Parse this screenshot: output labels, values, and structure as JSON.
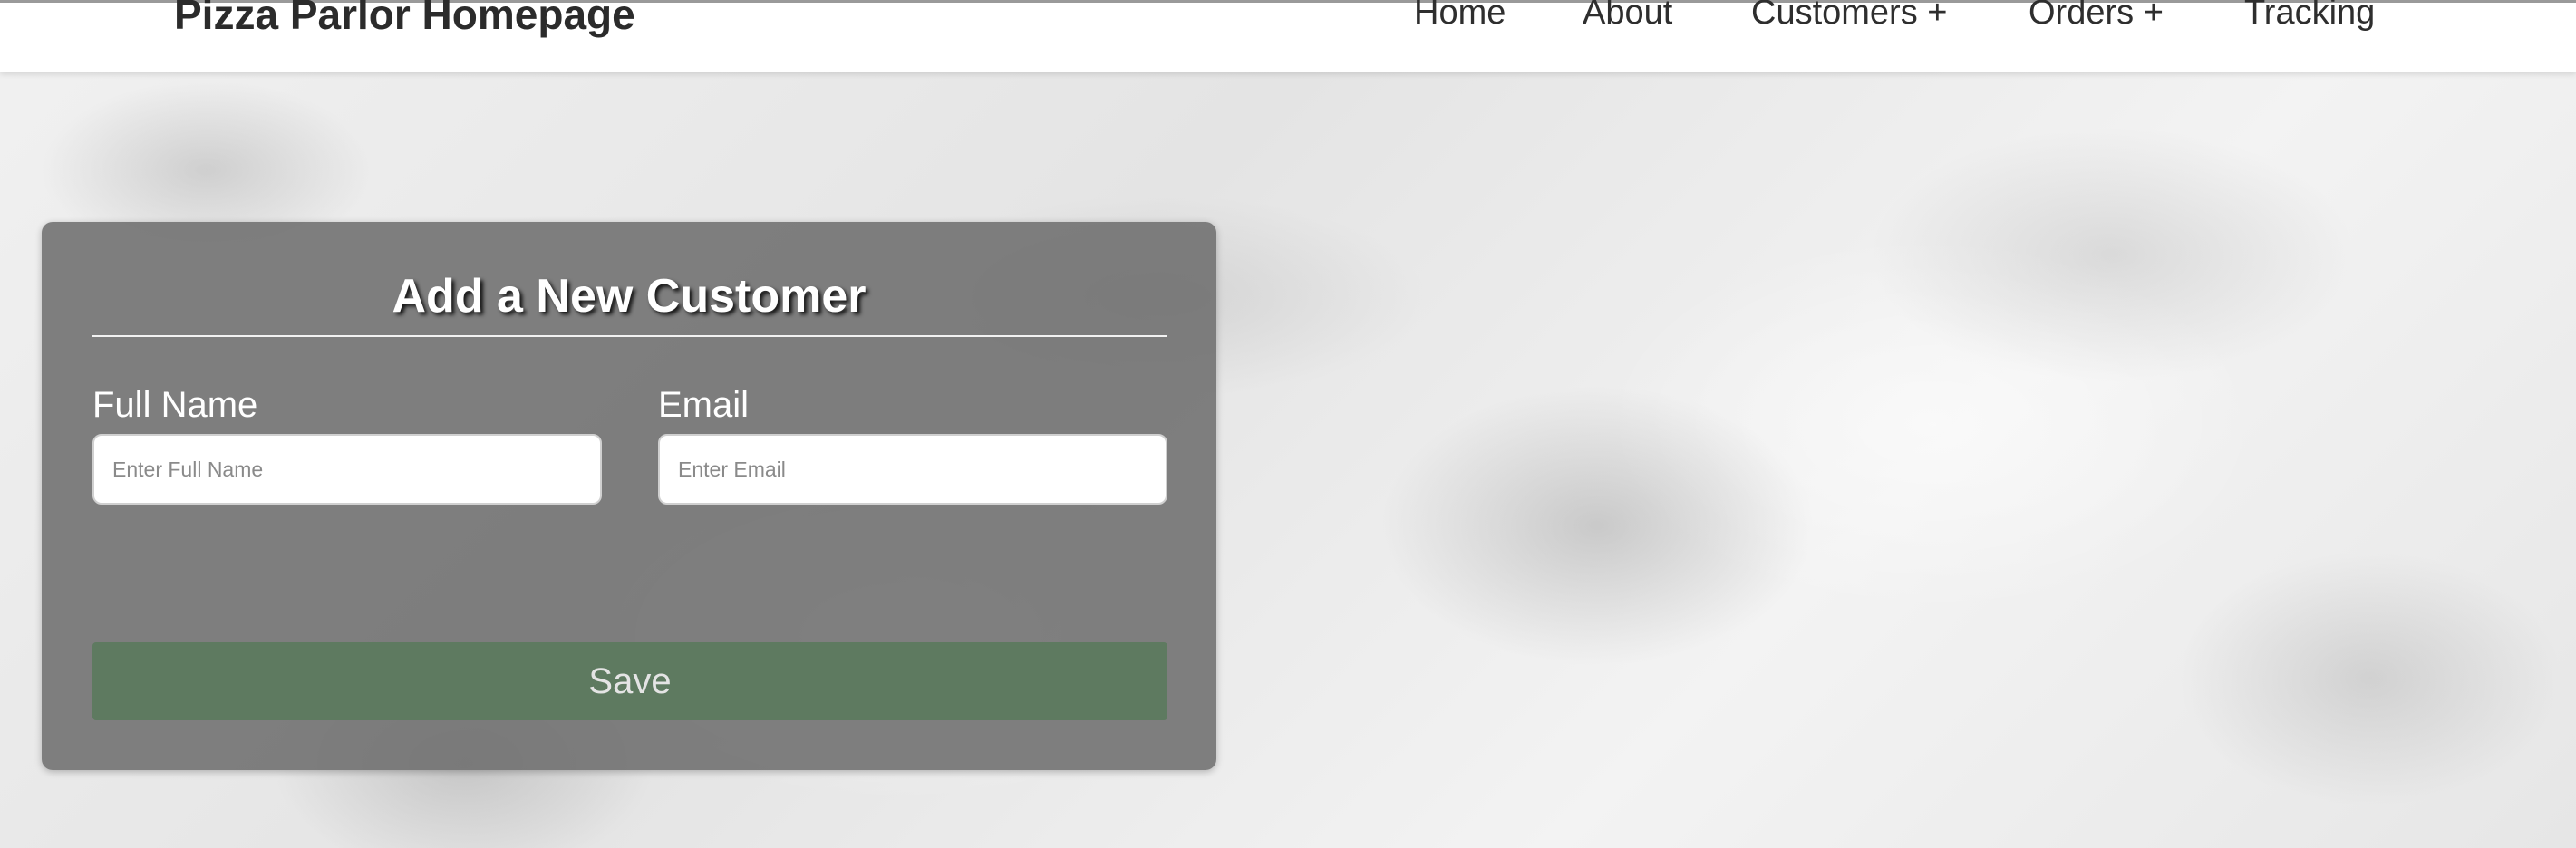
{
  "header": {
    "title": "Pizza Parlor Homepage",
    "nav": {
      "home": "Home",
      "about": "About",
      "customers": "Customers +",
      "orders": "Orders +",
      "tracking": "Tracking"
    }
  },
  "form": {
    "title": "Add a New Customer",
    "full_name": {
      "label": "Full Name",
      "placeholder": "Enter Full Name",
      "value": ""
    },
    "email": {
      "label": "Email",
      "placeholder": "Enter Email",
      "value": ""
    },
    "save_label": "Save"
  },
  "colors": {
    "card_background": "#6e6e6e",
    "save_button": "#5e7a60",
    "header_background": "#ffffff"
  }
}
